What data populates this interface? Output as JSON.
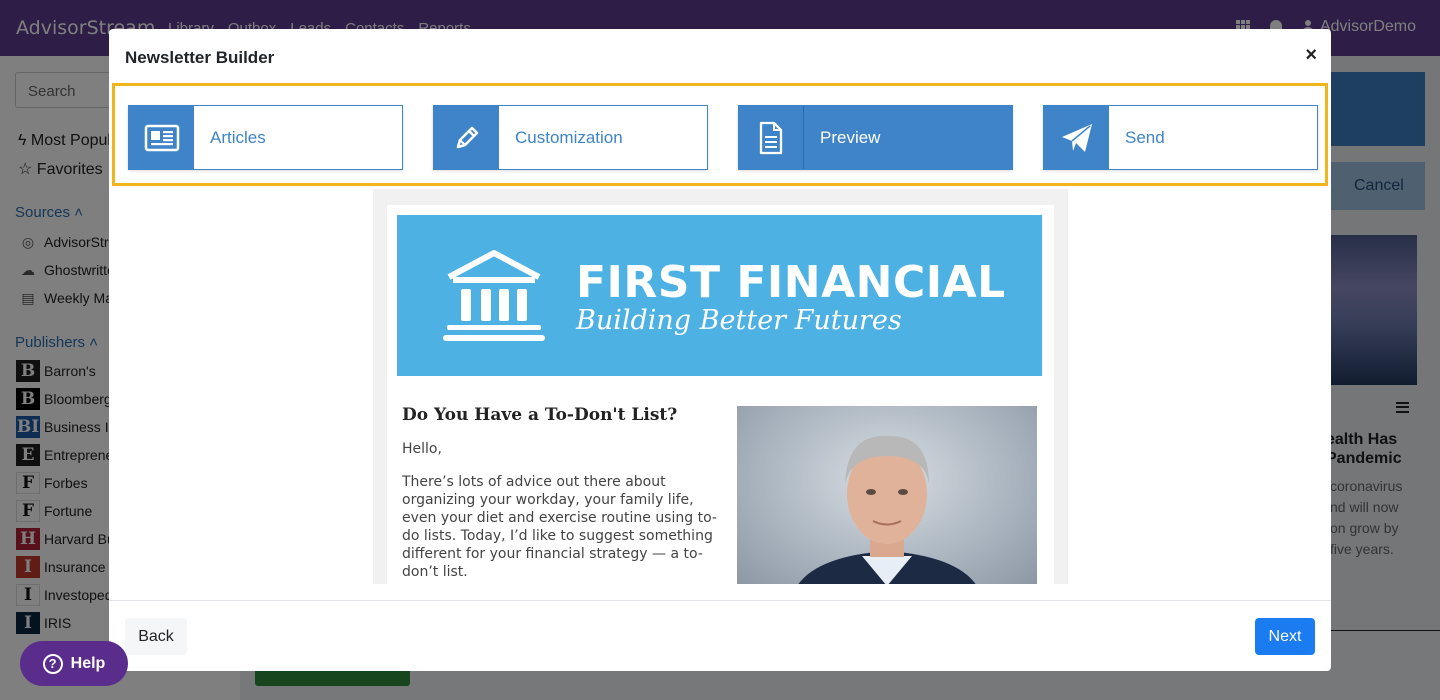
{
  "app": {
    "brand": "AdvisorStream",
    "nav": [
      "Library",
      "Outbox",
      "Leads",
      "Contacts",
      "Reports"
    ],
    "user": "AdvisorDemo"
  },
  "sidebar": {
    "search_placeholder": "Search",
    "links": [
      "Most Popular",
      "Favorites"
    ],
    "sources_label": "Sources",
    "sources": [
      "AdvisorStream",
      "Ghostwritten",
      "Weekly Market"
    ],
    "publishers_label": "Publishers",
    "publishers": [
      {
        "name": "Barron's",
        "letter": "B",
        "color": "#1f1f1f"
      },
      {
        "name": "Bloomberg",
        "letter": "B",
        "color": "#000000"
      },
      {
        "name": "Business Insider",
        "letter": "BI",
        "color": "#1c5aa6"
      },
      {
        "name": "Entrepreneur",
        "letter": "E",
        "color": "#1f1f1f"
      },
      {
        "name": "Forbes",
        "letter": "F",
        "color": "#ffffff"
      },
      {
        "name": "Fortune",
        "letter": "F",
        "color": "#ffffff"
      },
      {
        "name": "Harvard Business Review",
        "letter": "H",
        "color": "#b3203a"
      },
      {
        "name": "Insurance",
        "letter": "I",
        "color": "#c0392b"
      },
      {
        "name": "Investopedia",
        "letter": "I",
        "color": "#ffffff"
      },
      {
        "name": "IRIS",
        "letter": "I",
        "color": "#0a2540"
      }
    ]
  },
  "background_right": {
    "cancel_label": "Cancel",
    "card_title": "ealth Has\nPandemic",
    "card_text": "coronavirus\nnd will now\non grow by\nfive years."
  },
  "modal": {
    "title": "Newsletter Builder",
    "close_label": "×",
    "steps": [
      {
        "label": "Articles",
        "icon": "newspaper-icon",
        "active": false
      },
      {
        "label": "Customization",
        "icon": "pencil-icon",
        "active": false
      },
      {
        "label": "Preview",
        "icon": "document-icon",
        "active": true
      },
      {
        "label": "Send",
        "icon": "paper-plane-icon",
        "active": false
      }
    ],
    "newsletter": {
      "company_name": "FIRST FINANCIAL",
      "tagline": "Building Better Futures",
      "article_title": "Do You Have a To-Don't List?",
      "greeting": "Hello,",
      "body": "There’s lots of advice out there about organizing your workday, your family life, even your diet and exercise routine using to-do lists. Today, I’d like to suggest something different for your financial strategy — a to-don’t list."
    },
    "back_label": "Back",
    "next_label": "Next"
  },
  "help": {
    "label": "Help"
  },
  "colors": {
    "brand_purple": "#5b3a8e",
    "step_blue": "#3f84c8",
    "highlight": "#f0b61b",
    "banner_blue": "#4db1e3",
    "next_blue": "#1b7bf0"
  }
}
